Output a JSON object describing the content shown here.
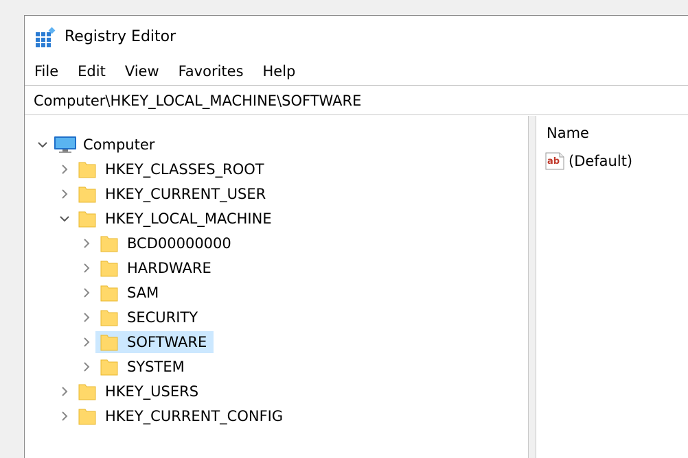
{
  "window": {
    "title": "Registry Editor",
    "icon": "registry-editor-icon"
  },
  "menu": [
    {
      "label": "File"
    },
    {
      "label": "Edit"
    },
    {
      "label": "View"
    },
    {
      "label": "Favorites"
    },
    {
      "label": "Help"
    }
  ],
  "address": {
    "path": "Computer\\HKEY_LOCAL_MACHINE\\SOFTWARE"
  },
  "tree": {
    "root": {
      "label": "Computer",
      "icon": "computer-icon",
      "expanded": true
    },
    "hives": [
      {
        "label": "HKEY_CLASSES_ROOT",
        "expanded": false
      },
      {
        "label": "HKEY_CURRENT_USER",
        "expanded": false
      },
      {
        "label": "HKEY_LOCAL_MACHINE",
        "expanded": true
      },
      {
        "label": "HKEY_USERS",
        "expanded": false
      },
      {
        "label": "HKEY_CURRENT_CONFIG",
        "expanded": false
      }
    ],
    "hklm_children": [
      {
        "label": "BCD00000000",
        "selected": false
      },
      {
        "label": "HARDWARE",
        "selected": false
      },
      {
        "label": "SAM",
        "selected": false
      },
      {
        "label": "SECURITY",
        "selected": false
      },
      {
        "label": "SOFTWARE",
        "selected": true
      },
      {
        "label": "SYSTEM",
        "selected": false
      }
    ],
    "selection_color": "#cce8ff",
    "folder_color": "#ffd869"
  },
  "values": {
    "columns": [
      {
        "label": "Name"
      }
    ],
    "rows": [
      {
        "name": "(Default)",
        "icon": "string-value-ab-icon"
      }
    ]
  }
}
